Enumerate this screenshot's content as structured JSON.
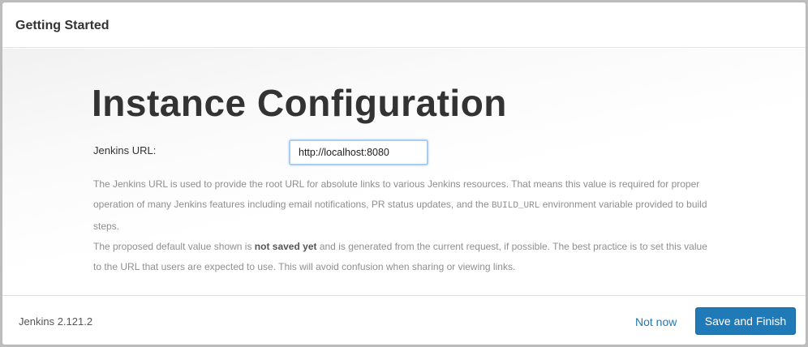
{
  "header": {
    "title": "Getting Started"
  },
  "main": {
    "title": "Instance Configuration",
    "url_label": "Jenkins URL:",
    "url_value": "http://localhost:8080",
    "help_line1_a": "The Jenkins URL is used to provide the root URL for absolute links to various Jenkins resources. That means this value is required for proper operation of many Jenkins features including email notifications, PR status updates, and the ",
    "help_line1_code": "BUILD_URL",
    "help_line1_b": " environment variable provided to build steps.",
    "help_line2_a": "The proposed default value shown is ",
    "help_line2_bold": "not saved yet",
    "help_line2_b": " and is generated from the current request, if possible. The best practice is to set this value to the URL that users are expected to use. This will avoid confusion when sharing or viewing links."
  },
  "footer": {
    "version": "Jenkins 2.121.2",
    "not_now_label": "Not now",
    "save_label": "Save and Finish"
  }
}
